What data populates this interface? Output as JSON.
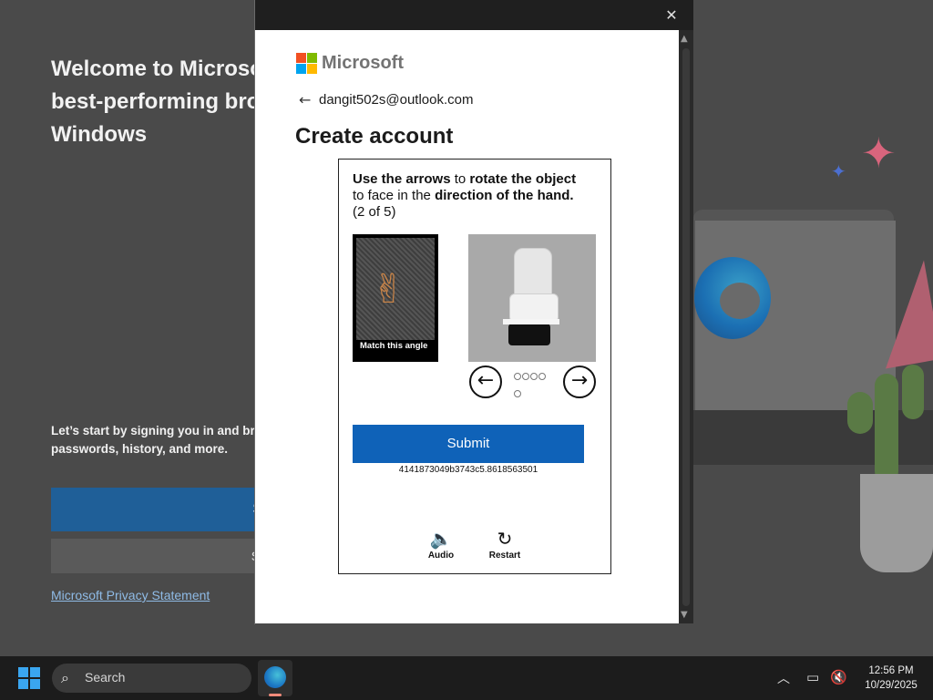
{
  "background_page": {
    "title": "Welcome to Microso best-performing bro Windows",
    "title_lines": [
      "Welcome to Microso",
      "best-performing bro",
      "Windows"
    ],
    "intro_lines": [
      "Let’s start by signing you in and bri",
      "passwords, history, and more."
    ],
    "sign_in_button": "Sign in to sync d",
    "start_without_button": "Start without your d",
    "privacy_link": "Microsoft Privacy Statement"
  },
  "dialog": {
    "close_icon": "close-icon",
    "brand": "Microsoft",
    "back_icon": "back-arrow-icon",
    "email": "dangit502s@outlook.com",
    "heading": "Create account",
    "captcha": {
      "instruction_parts": {
        "a": "Use the arrows",
        "b": " to ",
        "c": "rotate the object",
        "d": "to face in the ",
        "e": "direction of the hand.",
        "f": "(2 of 5)"
      },
      "hand_caption": "Match this angle",
      "left_arrow": "←",
      "right_arrow": "→",
      "progress_dots": 5,
      "submit_label": "Submit",
      "session_id": "4141873049b3743c5.8618563501",
      "audio_label": "Audio",
      "restart_label": "Restart"
    }
  },
  "taskbar": {
    "search_placeholder": "Search",
    "time": "12:56 PM",
    "date": "10/29/2025"
  },
  "colors": {
    "submit": "#0f62b8",
    "ms_red": "#f25022",
    "ms_green": "#7fba00",
    "ms_blue": "#00a4ef",
    "ms_yellow": "#ffb900",
    "windows_blue": "#3aa6f0"
  }
}
